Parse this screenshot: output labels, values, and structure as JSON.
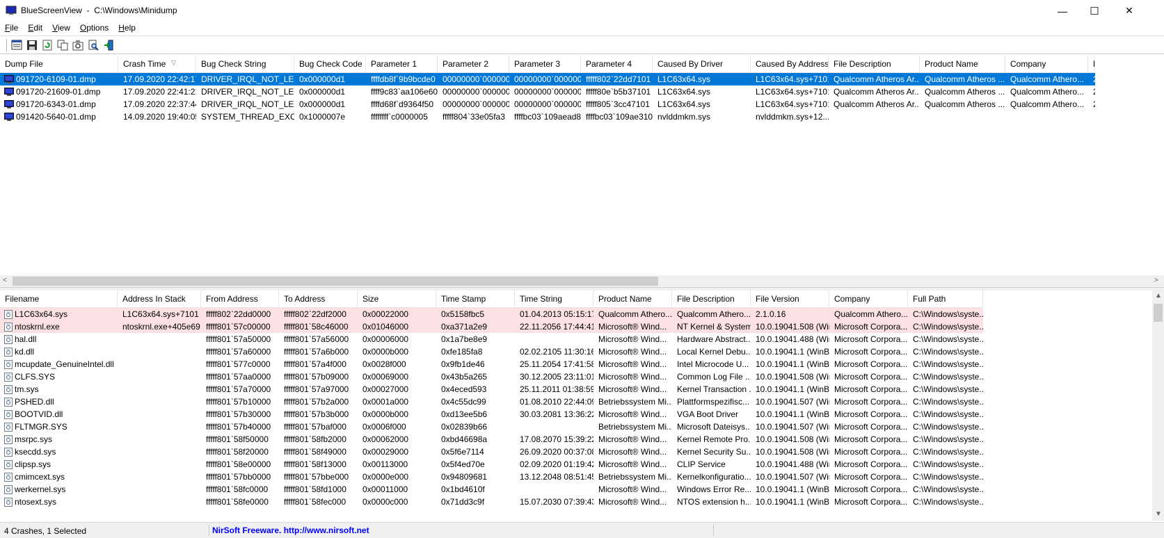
{
  "window": {
    "title": "BlueScreenView",
    "path": "C:\\Windows\\Minidump",
    "minimize": "—",
    "maximize": "☐",
    "close": "✕"
  },
  "menu": [
    {
      "label": "File",
      "key": "F",
      "rest": "ile"
    },
    {
      "label": "Edit",
      "key": "E",
      "rest": "dit"
    },
    {
      "label": "View",
      "key": "V",
      "rest": "iew"
    },
    {
      "label": "Options",
      "key": "O",
      "rest": "ptions"
    },
    {
      "label": "Help",
      "key": "H",
      "rest": "elp"
    }
  ],
  "toolbar": [
    "properties-icon",
    "save-icon",
    "refresh-icon",
    "copy-icon",
    "advanced-options-icon",
    "find-icon",
    "exit-icon"
  ],
  "crash_table": {
    "columns": [
      "Dump File",
      "Crash Time",
      "Bug Check String",
      "Bug Check Code",
      "Parameter 1",
      "Parameter 2",
      "Parameter 3",
      "Parameter 4",
      "Caused By Driver",
      "Caused By Address",
      "File Description",
      "Product Name",
      "Company",
      "F"
    ],
    "sort_indicator": "▽",
    "rows": [
      [
        "091720-6109-01.dmp",
        "17.09.2020 22:42:17",
        "DRIVER_IRQL_NOT_LESS...",
        "0x000000d1",
        "ffffdb8f`9b9bcde0",
        "00000000`000000...",
        "00000000`000000...",
        "fffff802`22dd7101",
        "L1C63x64.sys",
        "L1C63x64.sys+7101",
        "Qualcomm Atheros Ar...",
        "Qualcomm Atheros ...",
        "Qualcomm Athero...",
        "2"
      ],
      [
        "091720-21609-01.dmp",
        "17.09.2020 22:41:21",
        "DRIVER_IRQL_NOT_LESS...",
        "0x000000d1",
        "ffff9c83`aa106e60",
        "00000000`000000...",
        "00000000`000000...",
        "fffff80e`b5b37101",
        "L1C63x64.sys",
        "L1C63x64.sys+7101",
        "Qualcomm Atheros Ar...",
        "Qualcomm Atheros ...",
        "Qualcomm Athero...",
        "2"
      ],
      [
        "091720-6343-01.dmp",
        "17.09.2020 22:37:44",
        "DRIVER_IRQL_NOT_LESS...",
        "0x000000d1",
        "ffffd68f`d9364f50",
        "00000000`000000...",
        "00000000`000000...",
        "fffff805`3cc47101",
        "L1C63x64.sys",
        "L1C63x64.sys+7101",
        "Qualcomm Atheros Ar...",
        "Qualcomm Atheros ...",
        "Qualcomm Athero...",
        "2"
      ],
      [
        "091420-5640-01.dmp",
        "14.09.2020 19:40:05",
        "SYSTEM_THREAD_EXCE...",
        "0x1000007e",
        "ffffffff`c0000005",
        "fffff804`33e05fa3",
        "ffffbc03`109aead8",
        "ffffbc03`109ae310",
        "nvlddmkm.sys",
        "nvlddmkm.sys+12...",
        "",
        "",
        "",
        ""
      ]
    ],
    "selected_row": 0
  },
  "driver_table": {
    "columns": [
      "Filename",
      "Address In Stack",
      "From Address",
      "To Address",
      "Size",
      "Time Stamp",
      "Time String",
      "Product Name",
      "File Description",
      "File Version",
      "Company",
      "Full Path"
    ],
    "sort_indicator": "/",
    "rows": [
      [
        "L1C63x64.sys",
        "L1C63x64.sys+7101",
        "fffff802`22dd0000",
        "fffff802`22df2000",
        "0x00022000",
        "0x5158fbc5",
        "01.04.2013 05:15:17",
        "Qualcomm Athero...",
        "Qualcomm Athero...",
        "2.1.0.16",
        "Qualcomm Athero...",
        "C:\\Windows\\syste..."
      ],
      [
        "ntoskrnl.exe",
        "ntoskrnl.exe+405e69",
        "fffff801`57c00000",
        "fffff801`58c46000",
        "0x01046000",
        "0xa371a2e9",
        "22.11.2056 17:44:41",
        "Microsoft® Wind...",
        "NT Kernel & System",
        "10.0.19041.508 (Win...",
        "Microsoft Corpora...",
        "C:\\Windows\\syste..."
      ],
      [
        "hal.dll",
        "",
        "fffff801`57a50000",
        "fffff801`57a56000",
        "0x00006000",
        "0x1a7be8e9",
        "",
        "Microsoft® Wind...",
        "Hardware Abstract...",
        "10.0.19041.488 (Win...",
        "Microsoft Corpora...",
        "C:\\Windows\\syste..."
      ],
      [
        "kd.dll",
        "",
        "fffff801`57a60000",
        "fffff801`57a6b000",
        "0x0000b000",
        "0xfe185fa8",
        "02.02.2105 11:30:16",
        "Microsoft® Wind...",
        "Local Kernel Debu...",
        "10.0.19041.1 (WinB...",
        "Microsoft Corpora...",
        "C:\\Windows\\syste..."
      ],
      [
        "mcupdate_GenuineIntel.dll",
        "",
        "fffff801`577c0000",
        "fffff801`57a4f000",
        "0x0028f000",
        "0x9fb1de46",
        "25.11.2054 17:41:58",
        "Microsoft® Wind...",
        "Intel Microcode U...",
        "10.0.19041.1 (WinB...",
        "Microsoft Corpora...",
        "C:\\Windows\\syste..."
      ],
      [
        "CLFS.SYS",
        "",
        "fffff801`57aa0000",
        "fffff801`57b09000",
        "0x00069000",
        "0x43b5a265",
        "30.12.2005 23:11:01",
        "Microsoft® Wind...",
        "Common Log File ...",
        "10.0.19041.508 (Win...",
        "Microsoft Corpora...",
        "C:\\Windows\\syste..."
      ],
      [
        "tm.sys",
        "",
        "fffff801`57a70000",
        "fffff801`57a97000",
        "0x00027000",
        "0x4eced593",
        "25.11.2011 01:38:59",
        "Microsoft® Wind...",
        "Kernel Transaction ...",
        "10.0.19041.1 (WinB...",
        "Microsoft Corpora...",
        "C:\\Windows\\syste..."
      ],
      [
        "PSHED.dll",
        "",
        "fffff801`57b10000",
        "fffff801`57b2a000",
        "0x0001a000",
        "0x4c55dc99",
        "01.08.2010 22:44:09",
        "Betriebssystem Mi...",
        "Plattformspezifisc...",
        "10.0.19041.507 (Win...",
        "Microsoft Corpora...",
        "C:\\Windows\\syste..."
      ],
      [
        "BOOTVID.dll",
        "",
        "fffff801`57b30000",
        "fffff801`57b3b000",
        "0x0000b000",
        "0xd13ee5b6",
        "30.03.2081 13:36:22",
        "Microsoft® Wind...",
        "VGA Boot Driver",
        "10.0.19041.1 (WinB...",
        "Microsoft Corpora...",
        "C:\\Windows\\syste..."
      ],
      [
        "FLTMGR.SYS",
        "",
        "fffff801`57b40000",
        "fffff801`57baf000",
        "0x0006f000",
        "0x02839b66",
        "",
        "Betriebssystem Mi...",
        "Microsoft Dateisys...",
        "10.0.19041.507 (Win...",
        "Microsoft Corpora...",
        "C:\\Windows\\syste..."
      ],
      [
        "msrpc.sys",
        "",
        "fffff801`58f50000",
        "fffff801`58fb2000",
        "0x00062000",
        "0xbd46698a",
        "17.08.2070 15:39:22",
        "Microsoft® Wind...",
        "Kernel Remote Pro...",
        "10.0.19041.508 (Win...",
        "Microsoft Corpora...",
        "C:\\Windows\\syste..."
      ],
      [
        "ksecdd.sys",
        "",
        "fffff801`58f20000",
        "fffff801`58f49000",
        "0x00029000",
        "0x5f6e7114",
        "26.09.2020 00:37:08",
        "Microsoft® Wind...",
        "Kernel Security Su...",
        "10.0.19041.508 (Win...",
        "Microsoft Corpora...",
        "C:\\Windows\\syste..."
      ],
      [
        "clipsp.sys",
        "",
        "fffff801`58e00000",
        "fffff801`58f13000",
        "0x00113000",
        "0x5f4ed70e",
        "02.09.2020 01:19:42",
        "Microsoft® Wind...",
        "CLIP Service",
        "10.0.19041.488 (Win...",
        "Microsoft Corpora...",
        "C:\\Windows\\syste..."
      ],
      [
        "cmimcext.sys",
        "",
        "fffff801`57bb0000",
        "fffff801`57bbe000",
        "0x0000e000",
        "0x94809681",
        "13.12.2048 08:51:45",
        "Betriebssystem Mi...",
        "Kernelkonfiguratio...",
        "10.0.19041.507 (Win...",
        "Microsoft Corpora...",
        "C:\\Windows\\syste..."
      ],
      [
        "werkernel.sys",
        "",
        "fffff801`58fc0000",
        "fffff801`58fd1000",
        "0x00011000",
        "0x1bd4610f",
        "",
        "Microsoft® Wind...",
        "Windows Error Re...",
        "10.0.19041.1 (WinB...",
        "Microsoft Corpora...",
        "C:\\Windows\\syste..."
      ],
      [
        "ntosext.sys",
        "",
        "fffff801`58fe0000",
        "fffff801`58fec000",
        "0x0000c000",
        "0x71dd3c9f",
        "15.07.2030 07:39:43",
        "Microsoft® Wind...",
        "NTOS extension h...",
        "10.0.19041.1 (WinB...",
        "Microsoft Corpora...",
        "C:\\Windows\\syste..."
      ]
    ],
    "highlighted_rows": [
      0,
      1
    ]
  },
  "status": {
    "summary": "4 Crashes, 1 Selected",
    "link": "NirSoft Freeware.  http://www.nirsoft.net"
  },
  "colors": {
    "selection": "#0078d7",
    "highlight": "#fbe1e3",
    "link": "#0000ff"
  }
}
